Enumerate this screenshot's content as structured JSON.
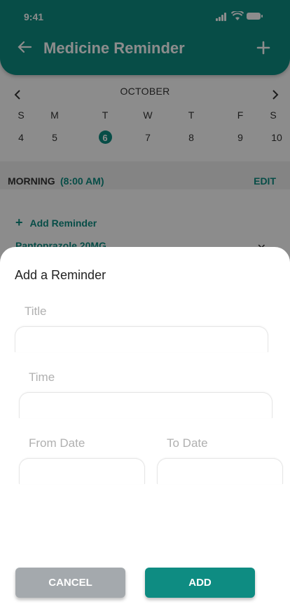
{
  "status": {
    "time": "9:41"
  },
  "header": {
    "title": "Medicine Reminder"
  },
  "calendar": {
    "month": "OCTOBER",
    "days": [
      "S",
      "M",
      "T",
      "W",
      "T",
      "F",
      "S"
    ],
    "dates": [
      "4",
      "5",
      "6",
      "7",
      "8",
      "9",
      "10"
    ],
    "selected_index": 2
  },
  "section": {
    "label": "MORNING",
    "time": "(8:00 AM)",
    "edit": "EDIT"
  },
  "list": {
    "add_reminder": "Add Reminder",
    "item": "Pantoprazole 20MG"
  },
  "sheet": {
    "title": "Add a Reminder",
    "fields": {
      "title_label": "Title",
      "time_label": "Time",
      "from_label": "From Date",
      "to_label": "To Date"
    },
    "buttons": {
      "cancel": "CANCEL",
      "add": "ADD"
    }
  },
  "colors": {
    "accent": "#0e8c82",
    "cancel": "#a4a9ad",
    "overlay": "rgba(0,0,0,0.45)"
  }
}
